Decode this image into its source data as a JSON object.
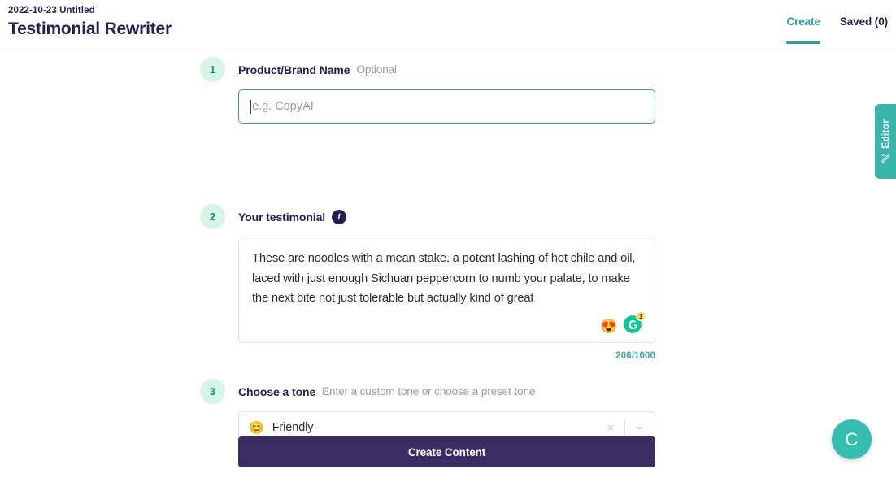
{
  "header": {
    "doc_date": "2022-10-23 Untitled",
    "title": "Testimonial Rewriter",
    "tabs": [
      {
        "label": "Create",
        "active": true
      },
      {
        "label": "Saved (0)",
        "active": false
      }
    ]
  },
  "steps": [
    {
      "number": "1",
      "label": "Product/Brand Name",
      "hint": "Optional",
      "input_value": "",
      "input_placeholder": "e.g. CopyAI"
    },
    {
      "number": "2",
      "label": "Your testimonial",
      "info_icon": "info-icon",
      "textarea_value": "These are noodles with a mean stake, a potent lashing of hot chile and oil, laced with just enough Sichuan peppercorn to numb your palate, to make the next bite not just tolerable but actually kind of great",
      "emoji_button": "😍",
      "grammarly_badge": "1",
      "counter": "206/1000"
    },
    {
      "number": "3",
      "label": "Choose a tone",
      "hint": "Enter a custom tone or choose a preset tone",
      "selected_emoji": "😊",
      "selected_value": "Friendly",
      "clear_icon": "×"
    }
  ],
  "submit": {
    "label": "Create Content"
  },
  "editor_tab": {
    "label": "Editor"
  },
  "fab": {
    "label": "C"
  },
  "colors": {
    "teal": "#2b9e9b",
    "navy": "#251d50",
    "purple": "#3b2d64",
    "mint": "#d6f5e6",
    "grammarly_green": "#15c39a",
    "badge_yellow": "#f8d64e"
  }
}
